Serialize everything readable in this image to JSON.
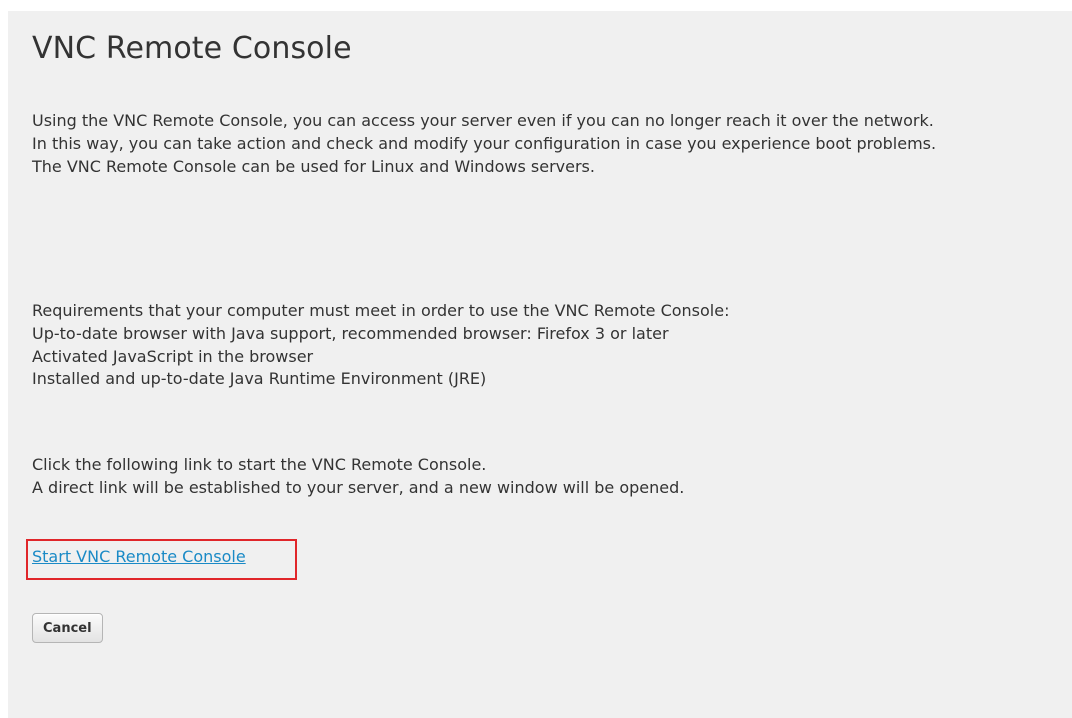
{
  "page": {
    "title": "VNC Remote Console"
  },
  "intro": {
    "lines": [
      "Using the VNC Remote Console, you can access your server even if you can no longer reach it over the network.",
      "In this way, you can take action and check and modify your configuration in case you experience boot problems.",
      "The VNC Remote Console can be used for Linux and Windows servers."
    ]
  },
  "requirements": {
    "heading": "Requirements that your computer must meet in order to use the VNC Remote Console:",
    "items": [
      "Up-to-date browser with Java support, recommended browser: Firefox 3 or later",
      "Activated JavaScript in the browser",
      "Installed and up-to-date Java Runtime Environment (JRE)"
    ]
  },
  "link_info": {
    "lines": [
      "Click the following link to start the VNC Remote Console.",
      "A direct link will be established to your server, and a new window will be opened."
    ]
  },
  "actions": {
    "start_link_label": "Start VNC Remote Console",
    "cancel_label": "Cancel"
  },
  "colors": {
    "panel_background": "#f0f0f0",
    "link": "#1a8ac6",
    "highlight_border": "#e0262a",
    "text": "#333333"
  }
}
